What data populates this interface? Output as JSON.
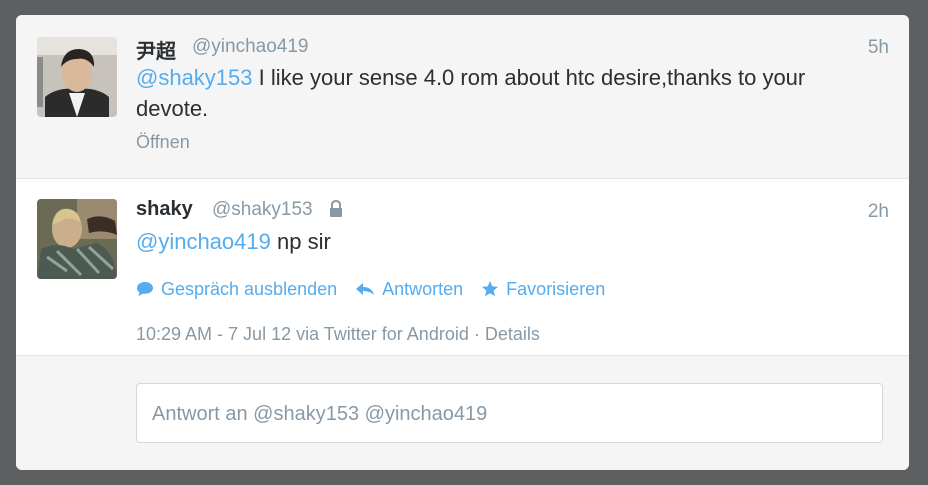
{
  "conversation": {
    "parent": {
      "name": "尹超",
      "handle": "@yinchao419",
      "time": "5h",
      "mention": "@shaky153",
      "text": " I like your sense 4.0 rom about htc desire,thanks to your devote.",
      "open_label": "Öffnen"
    },
    "main": {
      "name": "shaky",
      "handle": "@shaky153",
      "lock_icon": "lock-icon",
      "time": "2h",
      "mention": "@yinchao419",
      "text": " np sir",
      "actions": {
        "hide_conversation": "Gespräch ausblenden",
        "reply": "Antworten",
        "favorite": "Favorisieren"
      },
      "meta": {
        "timestamp": "10:29 AM - 7 Jul 12 via Twitter for Android",
        "separator": "·",
        "details": "Details"
      }
    },
    "reply": {
      "placeholder": "Antwort an @shaky153 @yinchao419"
    }
  },
  "colors": {
    "background": "#5e5f61",
    "accent": "#55acee",
    "muted": "#8899a6",
    "text": "#292f33"
  }
}
